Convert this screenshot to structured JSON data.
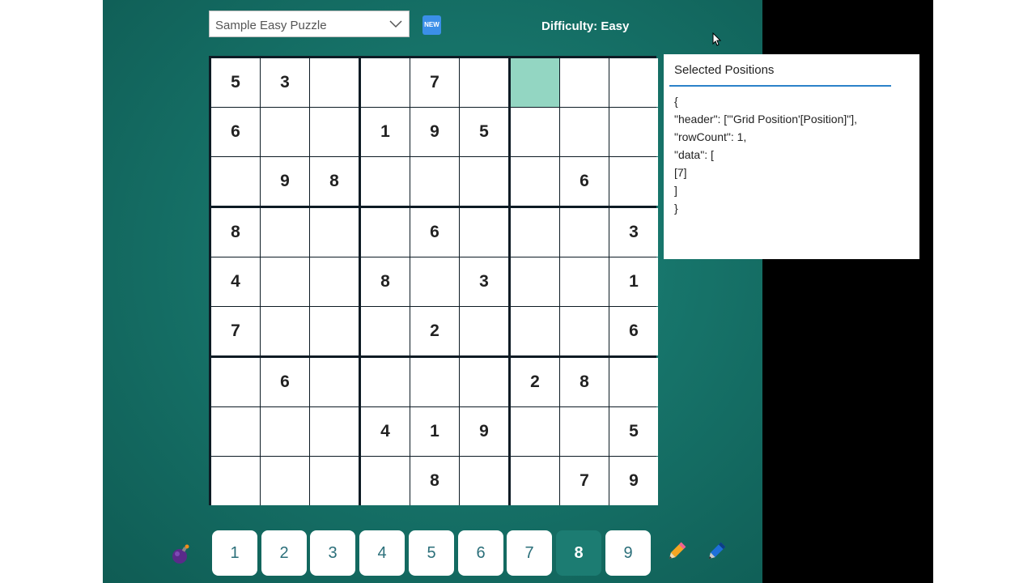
{
  "toolbar": {
    "puzzle_select_value": "Sample Easy Puzzle",
    "new_icon_text": "NEW",
    "difficulty": "Difficulty: Easy"
  },
  "board": {
    "rows": [
      [
        "5",
        "3",
        "",
        "",
        "7",
        "",
        "",
        "",
        ""
      ],
      [
        "6",
        "",
        "",
        "1",
        "9",
        "5",
        "",
        "",
        ""
      ],
      [
        "",
        "9",
        "8",
        "",
        "",
        "",
        "",
        "6",
        ""
      ],
      [
        "8",
        "",
        "",
        "",
        "6",
        "",
        "",
        "",
        "3"
      ],
      [
        "4",
        "",
        "",
        "8",
        "",
        "3",
        "",
        "",
        "1"
      ],
      [
        "7",
        "",
        "",
        "",
        "2",
        "",
        "",
        "",
        "6"
      ],
      [
        "",
        "6",
        "",
        "",
        "",
        "",
        "2",
        "8",
        ""
      ],
      [
        "",
        "",
        "",
        "4",
        "1",
        "9",
        "",
        "",
        "5"
      ],
      [
        "",
        "",
        "",
        "",
        "8",
        "",
        "",
        "7",
        "9"
      ]
    ],
    "selected": [
      [
        0,
        6
      ]
    ],
    "selected_color": "#93d6c2"
  },
  "panel": {
    "title": "Selected Positions",
    "lines": [
      "{",
      "\"header\": [\"'Grid Position'[Position]\"],",
      "\"rowCount\": 1,",
      "\"data\": [",
      "[7]",
      "]",
      "}"
    ]
  },
  "numpad": {
    "buttons": [
      "1",
      "2",
      "3",
      "4",
      "5",
      "6",
      "7",
      "8",
      "9"
    ],
    "active": "8",
    "active_color": "#1c7c72"
  },
  "icons": {
    "left": "bomb-icon",
    "pencil": "pencil-icon",
    "pen": "pen-icon"
  }
}
